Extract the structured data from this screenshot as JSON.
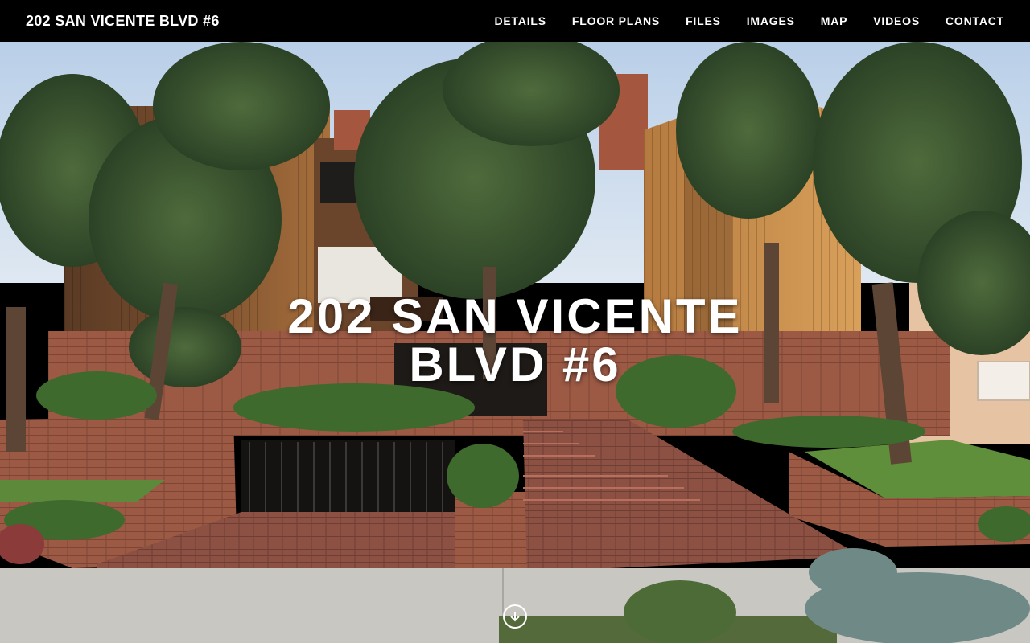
{
  "header": {
    "site_title": "202 SAN VICENTE BLVD #6",
    "nav": [
      {
        "label": "DETAILS"
      },
      {
        "label": "FLOOR PLANS"
      },
      {
        "label": "FILES"
      },
      {
        "label": "IMAGES"
      },
      {
        "label": "MAP"
      },
      {
        "label": "VIDEOS"
      },
      {
        "label": "CONTACT"
      }
    ]
  },
  "hero": {
    "title_line1": "202 SAN VICENTE",
    "title_line2": "BLVD #6",
    "scroll_icon": "arrow-down-circle-icon"
  },
  "colors": {
    "topbar_bg": "#000000",
    "text": "#ffffff"
  }
}
